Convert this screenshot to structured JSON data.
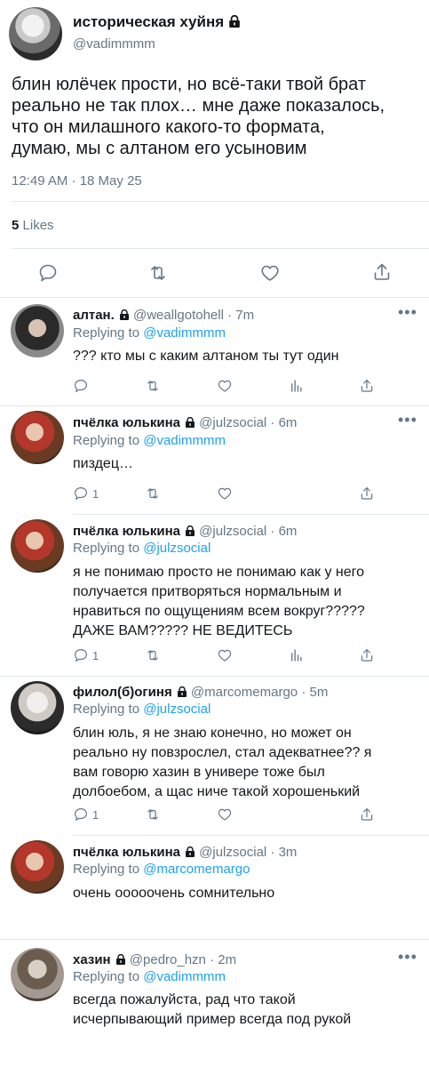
{
  "main": {
    "name": "историческая хуйня",
    "handle": "@vadimmmm",
    "text": [
      "блин юлёчек прости, но всё-таки твой брат",
      "реально не так плох… мне даже показалось,",
      "что он милашного какого-то формата,",
      "думаю, мы с алтаном его усыновим"
    ],
    "time": "12:49 AM · 18 May 25",
    "likes_count": "5",
    "likes_label": "Likes"
  },
  "replying_label": "Replying to",
  "replies": [
    {
      "name": "алтан.",
      "handle": "@weallgotohell",
      "time": "· 7m",
      "replying_to": "@vadimmmm",
      "text": [
        "??? кто мы с каким алтаном ты тут один"
      ],
      "reply_count": "",
      "stats_icon": true
    },
    {
      "name": "пчёлка юлькина",
      "handle": "@julzsocial",
      "time": "· 6m",
      "replying_to": "@vadimmmm",
      "text": [
        "пиздец…"
      ],
      "reply_count": "1",
      "stats_icon": false
    },
    {
      "name": "пчёлка юлькина",
      "handle": "@julzsocial",
      "time": "· 6m",
      "replying_to": "@julzsocial",
      "text": [
        "я не понимаю просто не понимаю как у него",
        "получается притворяться нормальным и",
        "нравиться по ощущениям всем вокруг?????",
        "ДАЖЕ ВАМ????? НЕ ВЕДИТЕСЬ"
      ],
      "reply_count": "1",
      "stats_icon": true
    },
    {
      "name": "филол(б)огиня",
      "handle": "@marcomemargo",
      "time": "· 5m",
      "replying_to": "@julzsocial",
      "text": [
        "блин юль, я не знаю конечно, но может он",
        "реально ну повзрослел, стал адекватнее?? я",
        "вам говорю хазин в универе тоже был",
        "долбоебом, а щас ниче такой хорошенький"
      ],
      "reply_count": "1",
      "stats_icon": false
    },
    {
      "name": "пчёлка юлькина",
      "handle": "@julzsocial",
      "time": "· 3m",
      "replying_to": "@marcomemargo",
      "text": [
        "очень ооооочень сомнительно"
      ],
      "reply_count": "",
      "stats_icon": false
    },
    {
      "name": "хазин",
      "handle": "@pedro_hzn",
      "time": "· 2m",
      "replying_to": "@vadimmmm",
      "text": [
        "всегда пожалуйста, рад что такой",
        "исчерпывающий пример всегда под рукой"
      ],
      "reply_count": "",
      "stats_icon": false
    }
  ],
  "colors": {
    "accent": "#1da1f2",
    "grey": "#657786",
    "divider": "#e1e8ed"
  },
  "icons": [
    "comment-icon",
    "retweet-icon",
    "heart-icon",
    "share-icon",
    "stats-icon",
    "lock-icon",
    "more-icon"
  ]
}
